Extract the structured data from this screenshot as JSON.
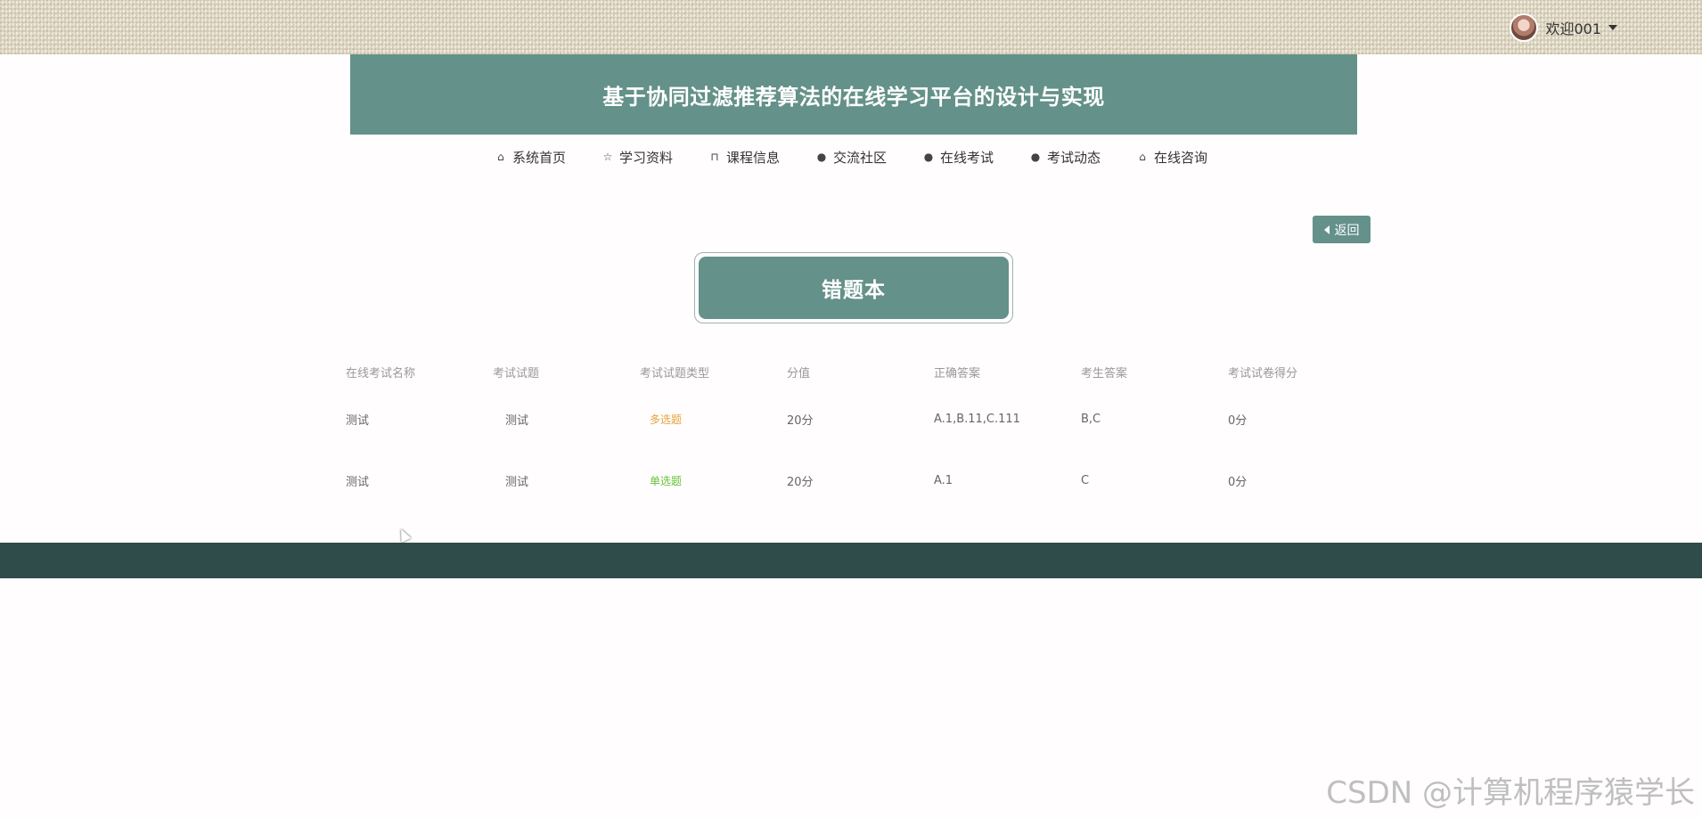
{
  "header": {
    "user_label": "欢迎001"
  },
  "banner": {
    "title": "基于协同过滤推荐算法的在线学习平台的设计与实现"
  },
  "nav": {
    "items": [
      {
        "label": "系统首页",
        "icon": "home-icon",
        "glyph": "⌂"
      },
      {
        "label": "学习资料",
        "icon": "star-icon",
        "glyph": "☆"
      },
      {
        "label": "课程信息",
        "icon": "lock-icon",
        "glyph": "⊓"
      },
      {
        "label": "交流社区",
        "icon": "exclamation-circle-icon",
        "glyph": "●"
      },
      {
        "label": "在线考试",
        "icon": "question-circle-icon",
        "glyph": "●"
      },
      {
        "label": "考试动态",
        "icon": "info-circle-icon",
        "glyph": "●"
      },
      {
        "label": "在线咨询",
        "icon": "home-icon",
        "glyph": "⌂"
      }
    ]
  },
  "back_button": {
    "label": "返回"
  },
  "section_title": "错题本",
  "table": {
    "headers": [
      "在线考试名称",
      "考试试题",
      "考试试题类型",
      "分值",
      "正确答案",
      "考生答案",
      "考试试卷得分"
    ],
    "rows": [
      {
        "exam_name": "测试",
        "question": "测试",
        "type": "多选题",
        "score": "20分",
        "correct": "A.1,B.11,C.111",
        "answer": "B,C",
        "paper_score": "0分"
      },
      {
        "exam_name": "测试",
        "question": "测试",
        "type": "单选题",
        "score": "20分",
        "correct": "A.1",
        "answer": "C",
        "paper_score": "0分"
      }
    ]
  },
  "watermark": "CSDN @计算机程序猿学长",
  "colors": {
    "accent": "#64918a",
    "footer": "#2f4b4a",
    "multi_tag": "#e6a23c",
    "single_tag": "#67c23a"
  }
}
